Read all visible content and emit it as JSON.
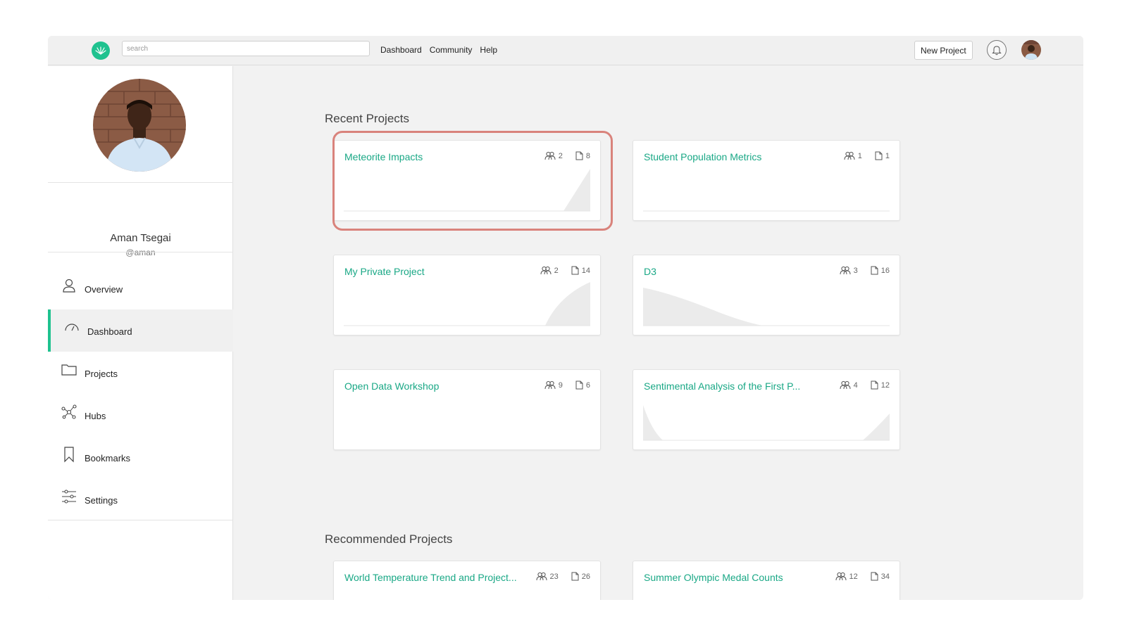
{
  "topbar": {
    "logo_icon": "leaf-logo-icon",
    "search_placeholder": "search",
    "nav": [
      "Dashboard",
      "Community",
      "Help"
    ],
    "new_project_label": "New Project",
    "bell_icon": "bell-icon"
  },
  "sidebar": {
    "user_name": "Aman Tsegai",
    "user_handle": "@aman",
    "menu": [
      {
        "label": "Overview",
        "icon": "user-icon"
      },
      {
        "label": "Dashboard",
        "icon": "speedometer-icon"
      },
      {
        "label": "Projects",
        "icon": "folder-icon"
      },
      {
        "label": "Hubs",
        "icon": "network-icon"
      },
      {
        "label": "Bookmarks",
        "icon": "bookmark-icon"
      },
      {
        "label": "Settings",
        "icon": "sliders-icon"
      }
    ],
    "active_item": "Dashboard"
  },
  "main": {
    "recent_title": "Recent Projects",
    "recommended_title": "Recommended Projects",
    "recent": [
      {
        "title": "Meteorite Impacts",
        "members": "2",
        "files": "8",
        "highlighted": true
      },
      {
        "title": "Student Population Metrics",
        "members": "1",
        "files": "1"
      },
      {
        "title": "My Private Project",
        "members": "2",
        "files": "14"
      },
      {
        "title": "D3",
        "members": "3",
        "files": "16"
      },
      {
        "title": "Open Data Workshop",
        "members": "9",
        "files": "6"
      },
      {
        "title": "Sentimental Analysis of the First P...",
        "members": "4",
        "files": "12"
      }
    ],
    "recommended": [
      {
        "title": "World Temperature Trend and Project...",
        "members": "23",
        "files": "26"
      },
      {
        "title": "Summer Olympic Medal Counts",
        "members": "12",
        "files": "34"
      }
    ]
  },
  "colors": {
    "accent": "#1fc28f",
    "link": "#1aa886",
    "highlight": "#d9837c"
  }
}
